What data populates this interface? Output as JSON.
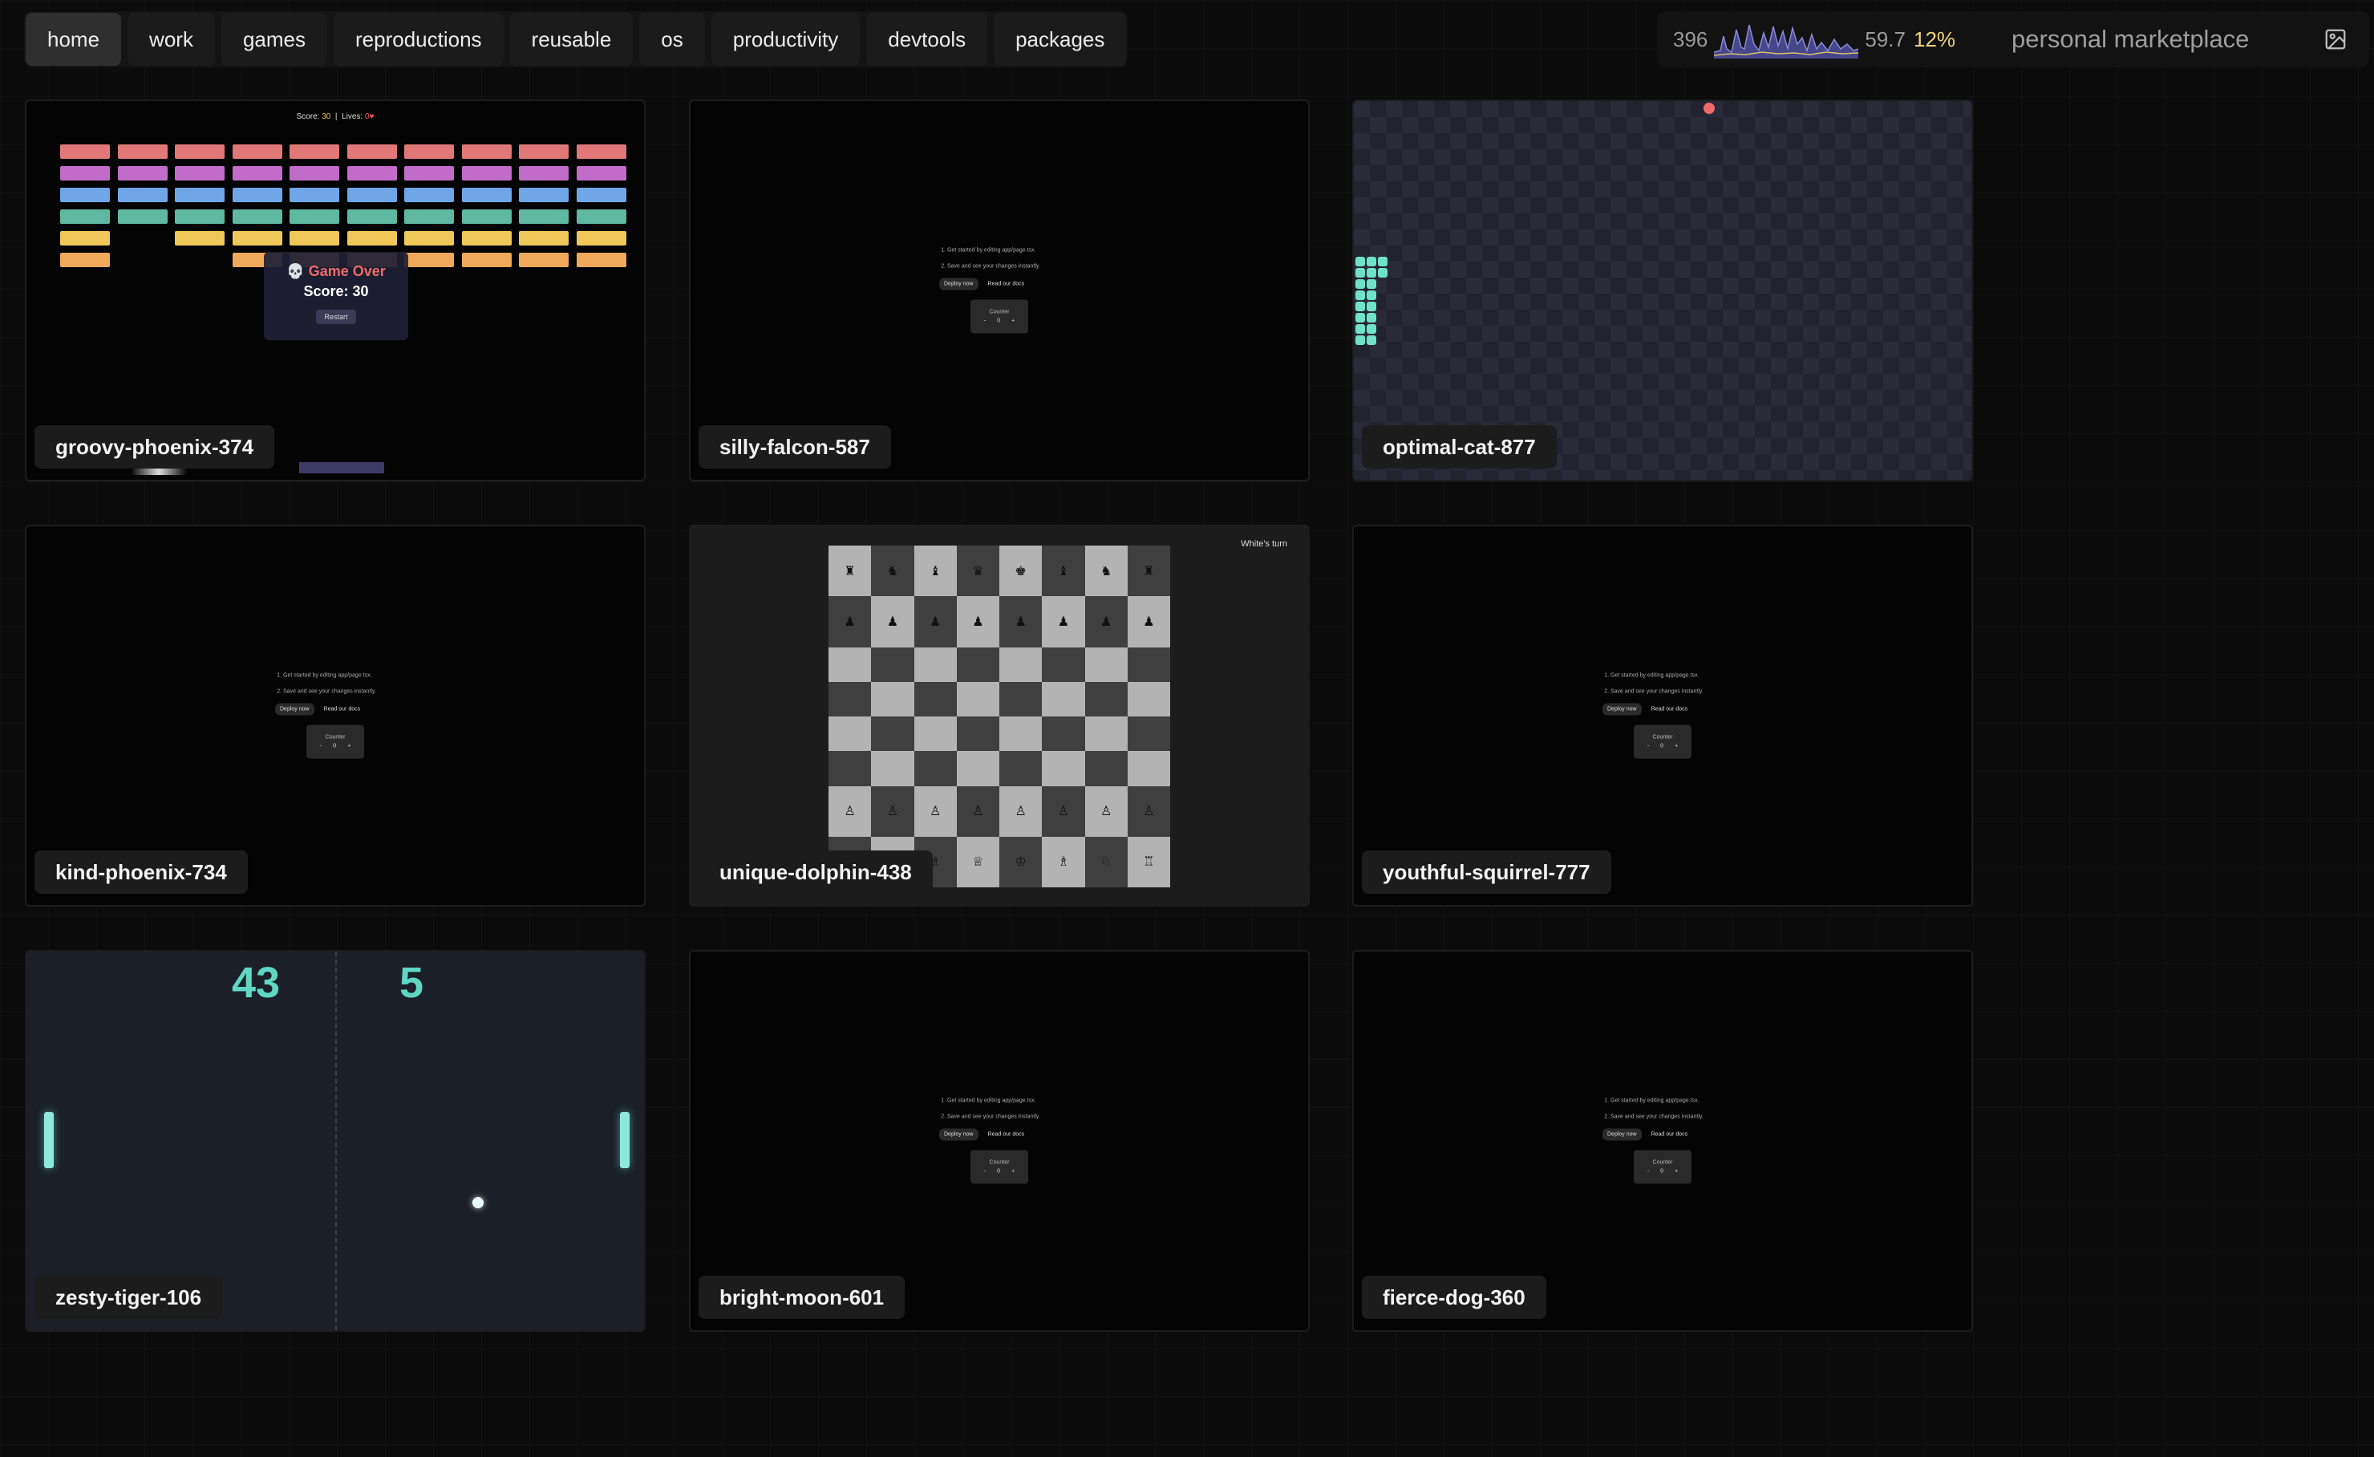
{
  "nav": {
    "tabs": [
      {
        "label": "home",
        "active": true
      },
      {
        "label": "work"
      },
      {
        "label": "games"
      },
      {
        "label": "reproductions"
      },
      {
        "label": "reusable"
      },
      {
        "label": "os"
      },
      {
        "label": "productivity"
      },
      {
        "label": "devtools"
      },
      {
        "label": "packages"
      }
    ]
  },
  "status": {
    "left_value": "396",
    "right_value": "59.7",
    "percent": "12%",
    "brand": "personal marketplace",
    "image_icon": "image-icon"
  },
  "starter": {
    "step1": "Get started by editing app/page.tsx.",
    "step2": "Save and see your changes instantly.",
    "deploy": "Deploy now",
    "docs": "Read our docs",
    "counter_label": "Counter",
    "counter_value": "0",
    "minus": "-",
    "plus": "+"
  },
  "cards": [
    {
      "name": "groovy-phoenix-374",
      "preview": "breakout"
    },
    {
      "name": "silly-falcon-587",
      "preview": "starter"
    },
    {
      "name": "optimal-cat-877",
      "preview": "snake"
    },
    {
      "name": "kind-phoenix-734",
      "preview": "starter"
    },
    {
      "name": "unique-dolphin-438",
      "preview": "chess"
    },
    {
      "name": "youthful-squirrel-777",
      "preview": "starter"
    },
    {
      "name": "zesty-tiger-106",
      "preview": "pong"
    },
    {
      "name": "bright-moon-601",
      "preview": "starter"
    },
    {
      "name": "fierce-dog-360",
      "preview": "starter"
    }
  ],
  "breakout": {
    "score_label": "Score:",
    "score": "30",
    "separator": "|",
    "lives_label": "Lives:",
    "lives": "0",
    "heart": "♥",
    "gameover": "Game Over",
    "gameover_icon": "skull-icon",
    "final_score": "Score: 30",
    "restart": "Restart"
  },
  "chess": {
    "turn": "White's turn",
    "rank8": [
      "♜",
      "♞",
      "♝",
      "♛",
      "♚",
      "♝",
      "♞",
      "♜"
    ],
    "rank7": [
      "♟",
      "♟",
      "♟",
      "♟",
      "♟",
      "♟",
      "♟",
      "♟"
    ],
    "rank2": [
      "♙",
      "♙",
      "♙",
      "♙",
      "♙",
      "♙",
      "♙",
      "♙"
    ],
    "rank1": [
      "♖",
      "♘",
      "♗",
      "♕",
      "♔",
      "♗",
      "♘",
      "♖"
    ]
  },
  "pong": {
    "left_score": "43",
    "right_score": "5"
  },
  "colors": {
    "brick_rows": [
      "#e07878",
      "#c06cc8",
      "#6fa6e8",
      "#5fb8a0",
      "#f0c85a",
      "#f0a95a"
    ],
    "accent": "#5fd7c4",
    "sparkline_fill": "#6a6ac8",
    "sparkline_line": "#d8c073"
  }
}
